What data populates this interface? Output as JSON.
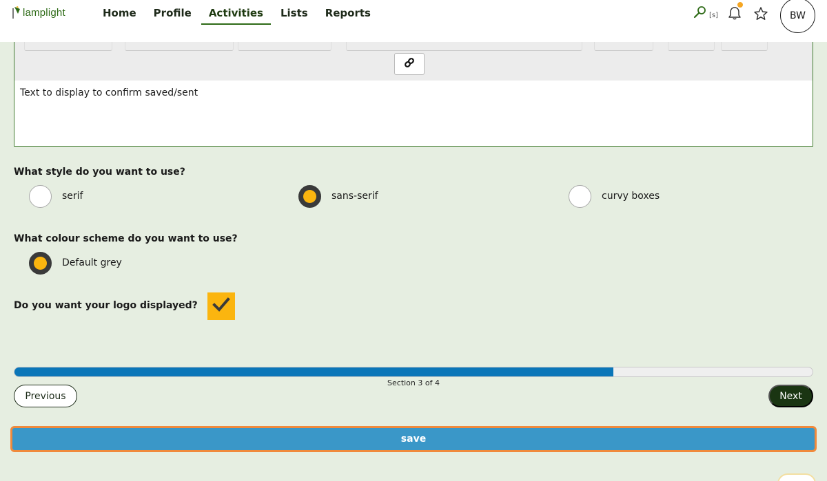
{
  "header": {
    "logo_text": "lamplight",
    "nav": [
      {
        "label": "Home",
        "active": false
      },
      {
        "label": "Profile",
        "active": false
      },
      {
        "label": "Activities",
        "active": true
      },
      {
        "label": "Lists",
        "active": false
      },
      {
        "label": "Reports",
        "active": false
      }
    ],
    "search_hint": "[s]",
    "avatar_initials": "BW",
    "notification_color": "#f5a623"
  },
  "editor": {
    "text": "Text to display to confirm saved/sent",
    "link_icon": "link-icon"
  },
  "style_question": {
    "label": "What style do you want to use?",
    "options": [
      {
        "label": "serif",
        "checked": false
      },
      {
        "label": "sans-serif",
        "checked": true
      },
      {
        "label": "curvy boxes",
        "checked": false
      }
    ]
  },
  "colour_question": {
    "label": "What colour scheme do you want to use?",
    "options": [
      {
        "label": "Default grey",
        "checked": true
      }
    ]
  },
  "logo_question": {
    "label": "Do you want your logo displayed?",
    "checked": true
  },
  "progress": {
    "label": "Section 3 of 4",
    "fraction": 0.75
  },
  "buttons": {
    "previous": "Previous",
    "next": "Next",
    "save": "save"
  },
  "colors": {
    "accent_green": "#2d6a16",
    "radio_selected": "#fbb50f",
    "progress_blue": "#0b76b8",
    "save_blue": "#3a97c8",
    "save_focus_outline": "#f08a3c",
    "background": "#e6eee1"
  }
}
